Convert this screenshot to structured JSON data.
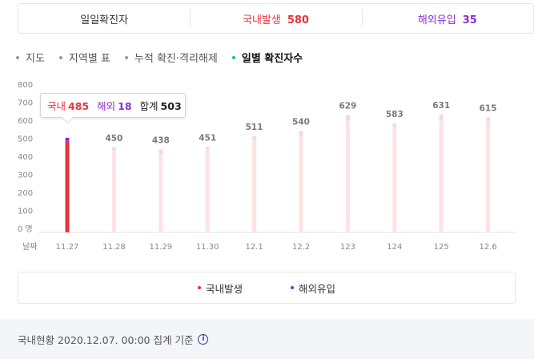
{
  "summary": {
    "daily_label": "일일확진자",
    "domestic_label": "국내발생",
    "domestic_value": "580",
    "overseas_label": "해외유입",
    "overseas_value": "35"
  },
  "tabs": [
    {
      "label": "지도",
      "active": false
    },
    {
      "label": "지역별 표",
      "active": false
    },
    {
      "label": "누적 확진·격리해제",
      "active": false
    },
    {
      "label": "일별 확진자수",
      "active": true
    }
  ],
  "tooltip": {
    "domestic_label": "국내",
    "domestic_value": "485",
    "overseas_label": "해외",
    "overseas_value": "18",
    "total_label": "합계",
    "total_value": "503"
  },
  "chart_data": {
    "type": "bar",
    "stacked": true,
    "xlabel": "날짜",
    "ylabel_unit": "명",
    "ylim": [
      0,
      800
    ],
    "yticks": [
      0,
      100,
      200,
      300,
      400,
      500,
      600,
      700,
      800
    ],
    "categories": [
      "11.27",
      "11.28",
      "11.29",
      "11.30",
      "12.1",
      "12.2",
      "12.3",
      "12.4",
      "12.5",
      "12.6"
    ],
    "category_labels": [
      "11.27",
      "11.28",
      "11.29",
      "11.30",
      "12.1",
      "12.2",
      "123",
      "124",
      "125",
      "12.6"
    ],
    "series": [
      {
        "name": "국내발생",
        "values": [
          485,
          432,
          412,
          438,
          493,
          511,
          600,
          562,
          601,
          594
        ]
      },
      {
        "name": "해외유입",
        "values": [
          18,
          18,
          26,
          13,
          18,
          29,
          29,
          21,
          30,
          21
        ]
      }
    ],
    "totals": [
      503,
      450,
      438,
      451,
      511,
      540,
      629,
      583,
      631,
      615
    ],
    "value_labels": [
      "",
      "450",
      "438",
      "451",
      "511",
      "540",
      "629",
      "583",
      "631",
      "615"
    ],
    "highlight_index": 0,
    "colors": {
      "domestic": "#e8333a",
      "domestic_dim": "#fde3e5",
      "overseas": "#8a2dd6",
      "overseas_dim": "#e8d8fa"
    }
  },
  "legend": {
    "domestic": "국내발생",
    "overseas": "해외유입"
  },
  "footer": {
    "text": "국내현황 2020.12.07. 00:00 집계 기준",
    "info_glyph": "i"
  }
}
